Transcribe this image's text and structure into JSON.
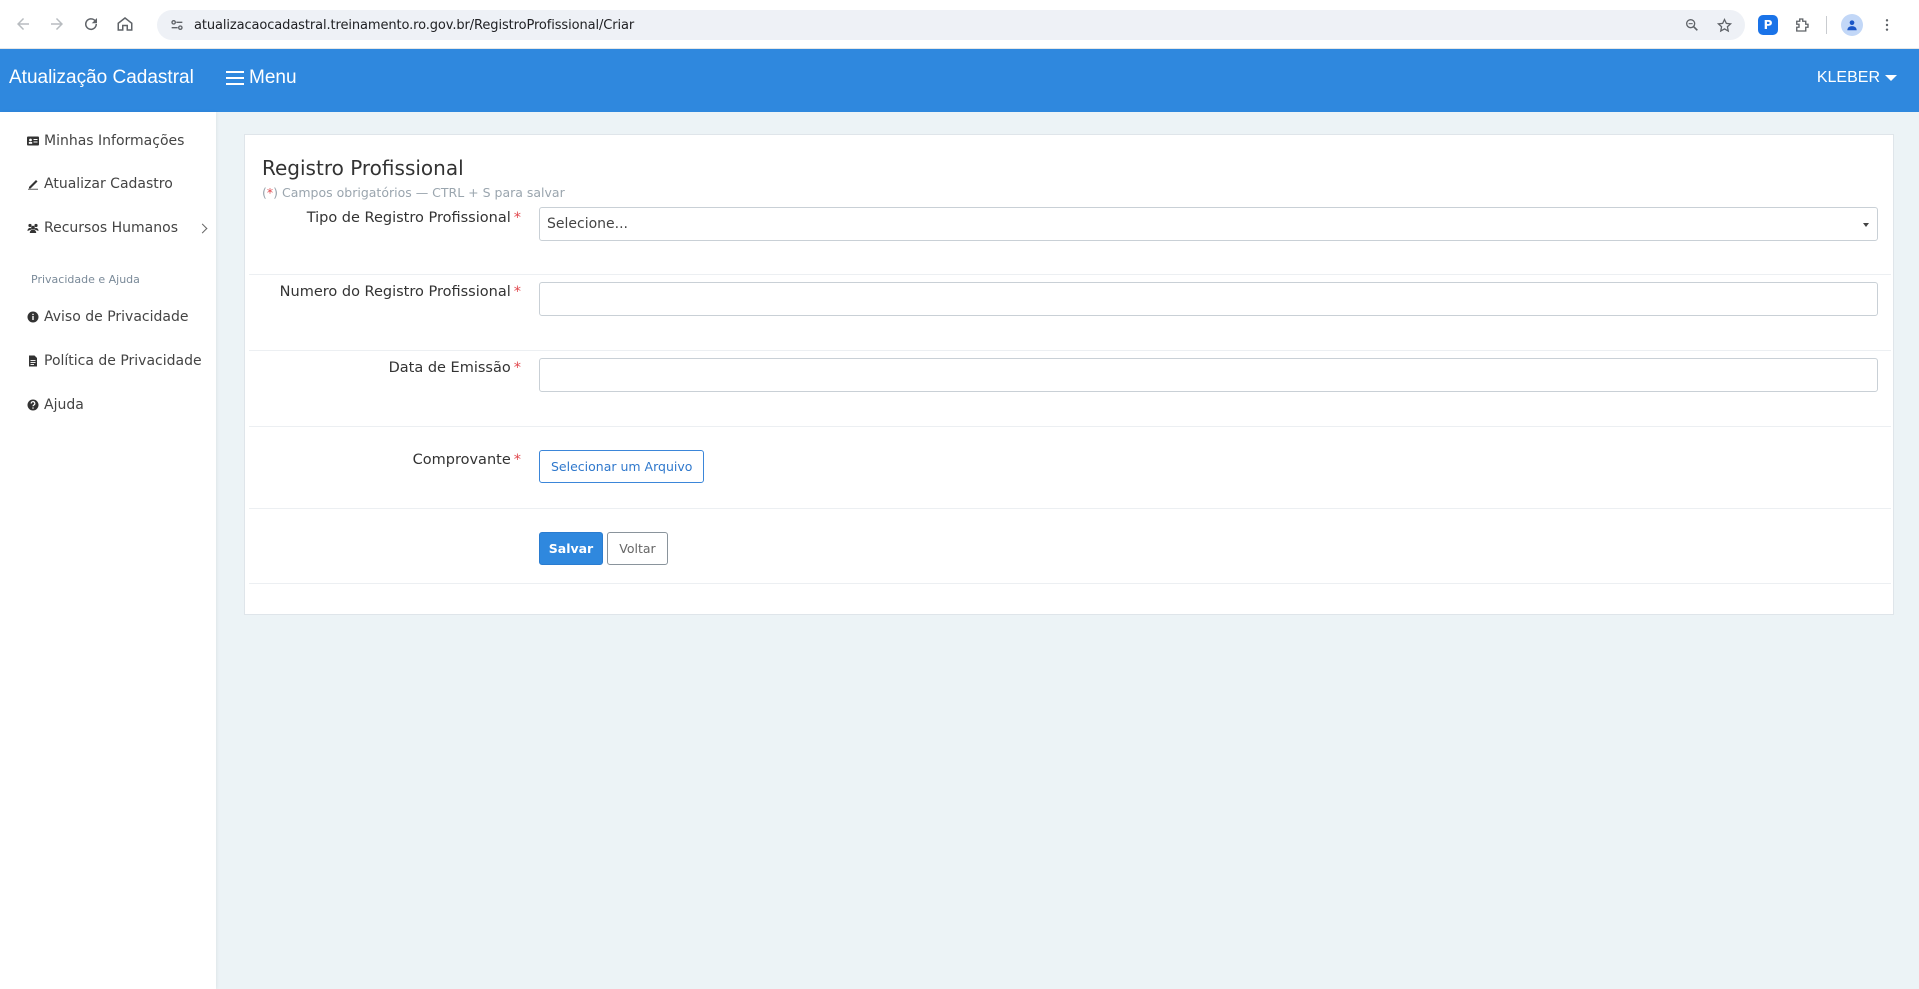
{
  "browser": {
    "url": "atualizacaocadastral.treinamento.ro.gov.br/RegistroProfissional/Criar"
  },
  "header": {
    "brand": "Atualização Cadastral",
    "menu_label": "Menu",
    "user": "KLEBER"
  },
  "sidebar": {
    "items": [
      {
        "label": "Minhas Informações",
        "icon": "id-card-icon"
      },
      {
        "label": "Atualizar Cadastro",
        "icon": "signature-icon"
      },
      {
        "label": "Recursos Humanos",
        "icon": "users-icon"
      }
    ],
    "section_title": "Privacidade e Ajuda",
    "help_items": [
      {
        "label": "Aviso de Privacidade",
        "icon": "info-circle-icon"
      },
      {
        "label": "Política de Privacidade",
        "icon": "file-text-icon"
      },
      {
        "label": "Ajuda",
        "icon": "question-circle-icon"
      }
    ]
  },
  "form": {
    "title": "Registro Profissional",
    "subtitle_prefix": "(",
    "subtitle_req": "*",
    "subtitle_rest": ") Campos obrigatórios — CTRL + S para salvar",
    "required_mark": "*",
    "fields": {
      "tipo_label": "Tipo de Registro Profissional",
      "tipo_value": "Selecione...",
      "numero_label": "Numero do Registro Profissional",
      "numero_value": "",
      "data_label": "Data de Emissão",
      "data_value": "",
      "comprovante_label": "Comprovante",
      "file_button": "Selecionar um Arquivo"
    },
    "buttons": {
      "save": "Salvar",
      "back": "Voltar"
    }
  },
  "colors": {
    "primary": "#2f88de",
    "required": "#e0474c",
    "background": "#ecf3f6"
  }
}
